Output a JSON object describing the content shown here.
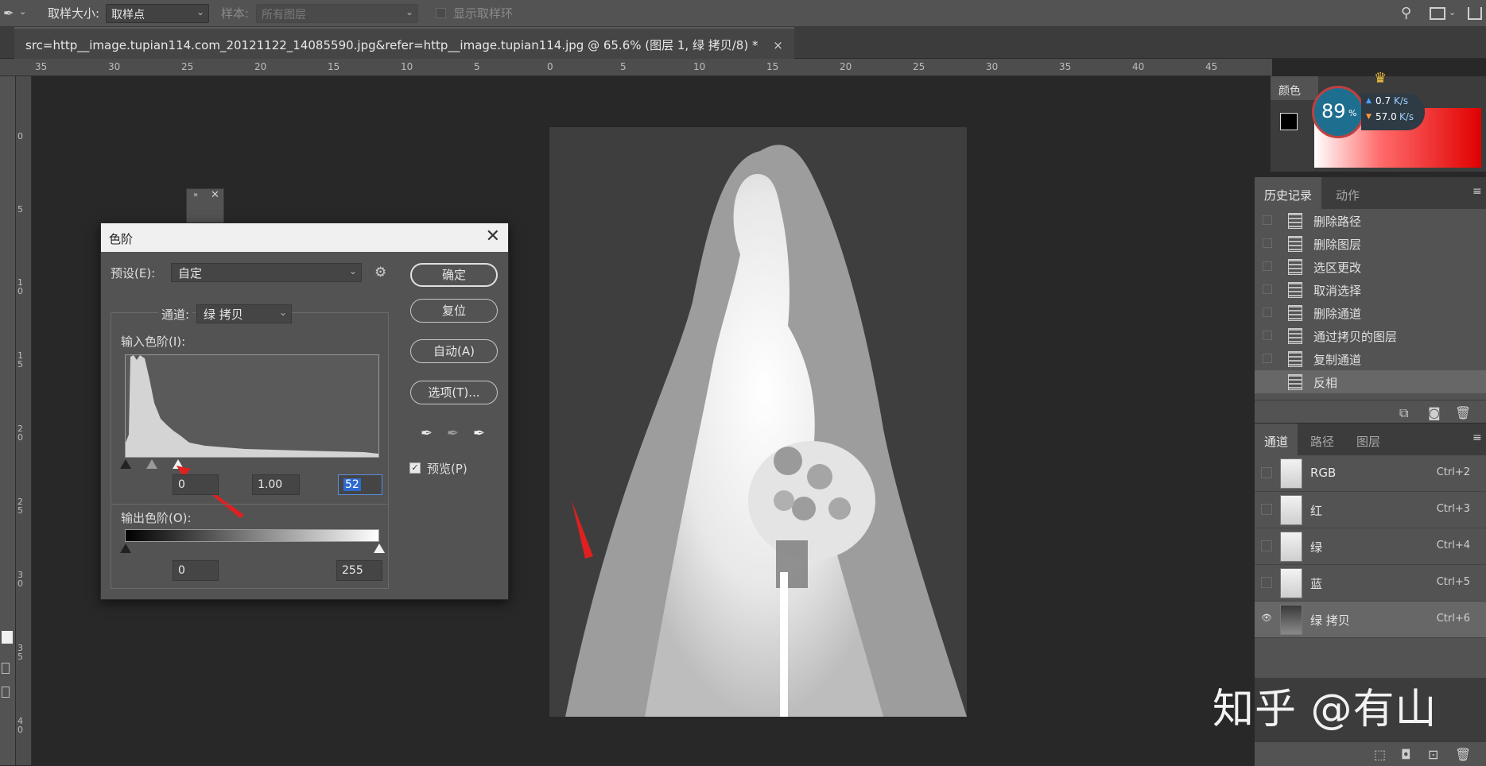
{
  "options_bar": {
    "sample_size_label": "取样大小:",
    "sample_size_value": "取样点",
    "sample_label": "样本:",
    "sample_value": "所有图层",
    "show_ring_label": "显示取样环"
  },
  "document_tab": {
    "title": "src=http__image.tupian114.com_20121122_14085590.jpg&refer=http__image.tupian114.jpg @ 65.6% (图层 1, 绿 拷贝/8) *",
    "close": "×"
  },
  "ruler_top_labels": [
    "35",
    "30",
    "25",
    "20",
    "15",
    "10",
    "5",
    "0",
    "5",
    "10",
    "15",
    "20",
    "25",
    "30",
    "35",
    "40",
    "45"
  ],
  "ruler_left_labels": [
    "0",
    "5",
    "1 0",
    "1 5",
    "2 0",
    "2 5",
    "3 0",
    "3 5",
    "4 0"
  ],
  "levels_dialog": {
    "title": "色阶",
    "close": "✕",
    "preset_label": "预设(E):",
    "preset_value": "自定",
    "channel_label": "通道:",
    "channel_value": "绿 拷贝",
    "input_levels_label": "输入色阶(I):",
    "input_black": "0",
    "input_gamma": "1.00",
    "input_white": "52",
    "output_levels_label": "输出色阶(O):",
    "output_black": "0",
    "output_white": "255",
    "ok_button": "确定",
    "reset_button": "复位",
    "auto_button": "自动(A)",
    "options_button": "选项(T)...",
    "preview_label": "预览(P)",
    "preview_checked": true
  },
  "color_panel": {
    "tab": "颜色"
  },
  "speed_widget": {
    "percent": "89",
    "percent_sign": "%",
    "upload": "0.7",
    "upload_unit": "K/s",
    "download": "57.0",
    "download_unit": "K/s"
  },
  "history_panel": {
    "tabs": [
      "历史记录",
      "动作"
    ],
    "items": [
      {
        "label": "删除路径"
      },
      {
        "label": "删除图层"
      },
      {
        "label": "选区更改"
      },
      {
        "label": "取消选择"
      },
      {
        "label": "删除通道"
      },
      {
        "label": "通过拷贝的图层"
      },
      {
        "label": "复制通道"
      },
      {
        "label": "反相"
      }
    ]
  },
  "channels_panel": {
    "tabs": [
      "通道",
      "路径",
      "图层"
    ],
    "channels": [
      {
        "name": "RGB",
        "shortcut": "Ctrl+2"
      },
      {
        "name": "红",
        "shortcut": "Ctrl+3"
      },
      {
        "name": "绿",
        "shortcut": "Ctrl+4"
      },
      {
        "name": "蓝",
        "shortcut": "Ctrl+5"
      },
      {
        "name": "绿 拷贝",
        "shortcut": "Ctrl+6"
      }
    ]
  },
  "watermark": "知乎 @有山",
  "colors": {
    "accent_red": "#e02020",
    "panel_bg": "#535353",
    "dialog_title_bg": "#f0f0f0"
  }
}
